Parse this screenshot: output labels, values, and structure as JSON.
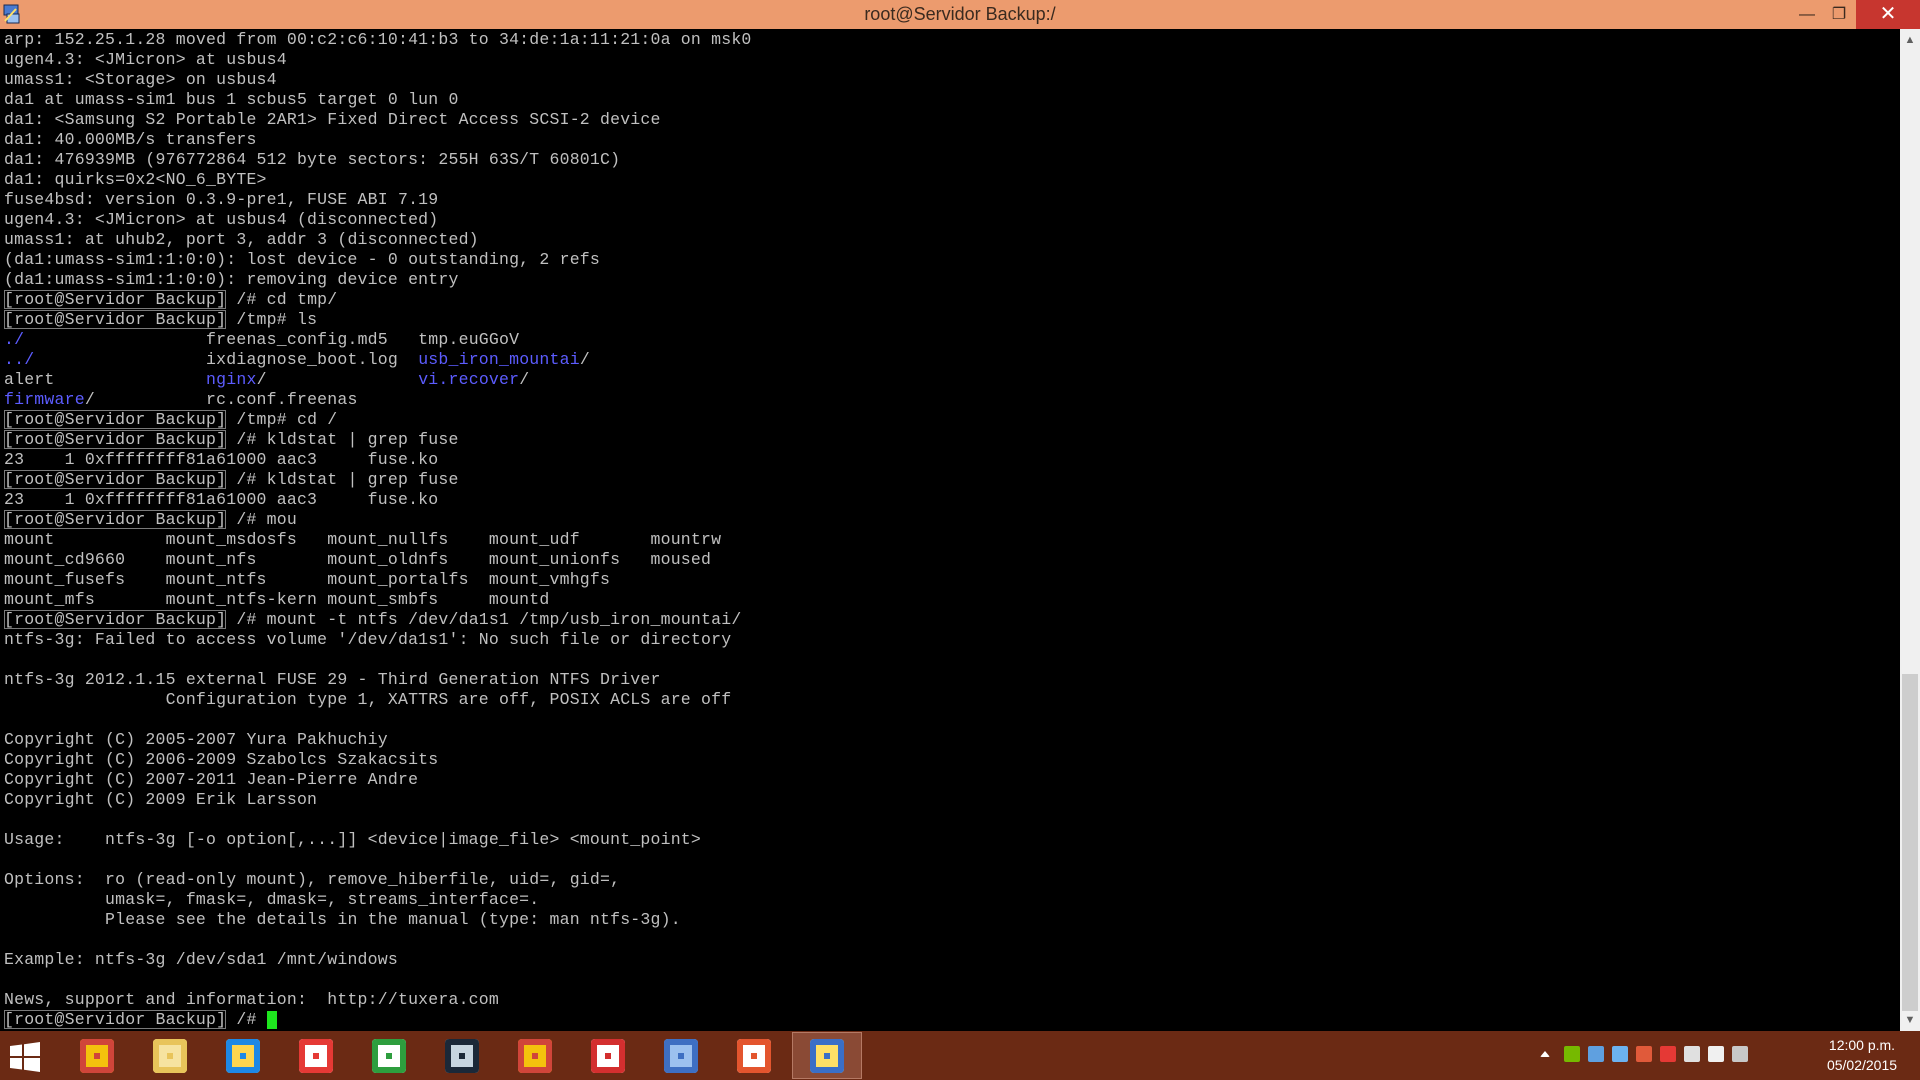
{
  "window": {
    "title": "root@Servidor Backup:/",
    "min_glyph": "—",
    "max_glyph": "❐",
    "close_glyph": "✕"
  },
  "terminal": {
    "lines": [
      {
        "segments": [
          {
            "text": "arp: 152.25.1.28 moved from 00:c2:c6:10:41:b3 to 34:de:1a:11:21:0a on msk0"
          }
        ]
      },
      {
        "segments": [
          {
            "text": "ugen4.3: <JMicron> at usbus4"
          }
        ]
      },
      {
        "segments": [
          {
            "text": "umass1: <Storage> on usbus4"
          }
        ]
      },
      {
        "segments": [
          {
            "text": "da1 at umass-sim1 bus 1 scbus5 target 0 lun 0"
          }
        ]
      },
      {
        "segments": [
          {
            "text": "da1: <Samsung S2 Portable 2AR1> Fixed Direct Access SCSI-2 device"
          }
        ]
      },
      {
        "segments": [
          {
            "text": "da1: 40.000MB/s transfers"
          }
        ]
      },
      {
        "segments": [
          {
            "text": "da1: 476939MB (976772864 512 byte sectors: 255H 63S/T 60801C)"
          }
        ]
      },
      {
        "segments": [
          {
            "text": "da1: quirks=0x2<NO_6_BYTE>"
          }
        ]
      },
      {
        "segments": [
          {
            "text": "fuse4bsd: version 0.3.9-pre1, FUSE ABI 7.19"
          }
        ]
      },
      {
        "segments": [
          {
            "text": "ugen4.3: <JMicron> at usbus4 (disconnected)"
          }
        ]
      },
      {
        "segments": [
          {
            "text": "umass1: at uhub2, port 3, addr 3 (disconnected)"
          }
        ]
      },
      {
        "segments": [
          {
            "text": "(da1:umass-sim1:1:0:0): lost device - 0 outstanding, 2 refs"
          }
        ]
      },
      {
        "segments": [
          {
            "text": "(da1:umass-sim1:1:0:0): removing device entry"
          }
        ]
      },
      {
        "segments": [
          {
            "text": "[root@Servidor Backup]",
            "cls": "prompt-box"
          },
          {
            "text": " /# cd tmp/"
          }
        ]
      },
      {
        "segments": [
          {
            "text": "[root@Servidor Backup]",
            "cls": "prompt-box"
          },
          {
            "text": " /tmp# ls"
          }
        ]
      },
      {
        "segments": [
          {
            "text": "./",
            "cls": "dir"
          },
          {
            "text": "                  freenas_config.md5   tmp.euGGoV"
          }
        ]
      },
      {
        "segments": [
          {
            "text": "../",
            "cls": "dir"
          },
          {
            "text": "                 ixdiagnose_boot.log  "
          },
          {
            "text": "usb_iron_mountai",
            "cls": "dir"
          },
          {
            "text": "/"
          }
        ]
      },
      {
        "segments": [
          {
            "text": "alert               "
          },
          {
            "text": "nginx",
            "cls": "dir"
          },
          {
            "text": "/               "
          },
          {
            "text": "vi.recover",
            "cls": "dir"
          },
          {
            "text": "/"
          }
        ]
      },
      {
        "segments": [
          {
            "text": "firmware",
            "cls": "dir"
          },
          {
            "text": "/           rc.conf.freenas"
          }
        ]
      },
      {
        "segments": [
          {
            "text": "[root@Servidor Backup]",
            "cls": "prompt-box"
          },
          {
            "text": " /tmp# cd /"
          }
        ]
      },
      {
        "segments": [
          {
            "text": "[root@Servidor Backup]",
            "cls": "prompt-box"
          },
          {
            "text": " /# kldstat | grep fuse"
          }
        ]
      },
      {
        "segments": [
          {
            "text": "23    1 0xffffffff81a61000 aac3     fuse.ko"
          }
        ]
      },
      {
        "segments": [
          {
            "text": "[root@Servidor Backup]",
            "cls": "prompt-box"
          },
          {
            "text": " /# kldstat | grep fuse"
          }
        ]
      },
      {
        "segments": [
          {
            "text": "23    1 0xffffffff81a61000 aac3     fuse.ko"
          }
        ]
      },
      {
        "segments": [
          {
            "text": "[root@Servidor Backup]",
            "cls": "prompt-box"
          },
          {
            "text": " /# mou"
          }
        ]
      },
      {
        "segments": [
          {
            "text": "mount           mount_msdosfs   mount_nullfs    mount_udf       mountrw"
          }
        ]
      },
      {
        "segments": [
          {
            "text": "mount_cd9660    mount_nfs       mount_oldnfs    mount_unionfs   moused"
          }
        ]
      },
      {
        "segments": [
          {
            "text": "mount_fusefs    mount_ntfs      mount_portalfs  mount_vmhgfs"
          }
        ]
      },
      {
        "segments": [
          {
            "text": "mount_mfs       mount_ntfs-kern mount_smbfs     mountd"
          }
        ]
      },
      {
        "segments": [
          {
            "text": "[root@Servidor Backup]",
            "cls": "prompt-box"
          },
          {
            "text": " /# mount -t ntfs /dev/da1s1 /tmp/usb_iron_mountai/"
          }
        ]
      },
      {
        "segments": [
          {
            "text": "ntfs-3g: Failed to access volume '/dev/da1s1': No such file or directory"
          }
        ]
      },
      {
        "segments": [
          {
            "text": ""
          }
        ]
      },
      {
        "segments": [
          {
            "text": "ntfs-3g 2012.1.15 external FUSE 29 - Third Generation NTFS Driver"
          }
        ]
      },
      {
        "segments": [
          {
            "text": "                Configuration type 1, XATTRS are off, POSIX ACLS are off"
          }
        ]
      },
      {
        "segments": [
          {
            "text": ""
          }
        ]
      },
      {
        "segments": [
          {
            "text": "Copyright (C) 2005-2007 Yura Pakhuchiy"
          }
        ]
      },
      {
        "segments": [
          {
            "text": "Copyright (C) 2006-2009 Szabolcs Szakacsits"
          }
        ]
      },
      {
        "segments": [
          {
            "text": "Copyright (C) 2007-2011 Jean-Pierre Andre"
          }
        ]
      },
      {
        "segments": [
          {
            "text": "Copyright (C) 2009 Erik Larsson"
          }
        ]
      },
      {
        "segments": [
          {
            "text": ""
          }
        ]
      },
      {
        "segments": [
          {
            "text": "Usage:    ntfs-3g [-o option[,...]] <device|image_file> <mount_point>"
          }
        ]
      },
      {
        "segments": [
          {
            "text": ""
          }
        ]
      },
      {
        "segments": [
          {
            "text": "Options:  ro (read-only mount), remove_hiberfile, uid=, gid=,"
          }
        ]
      },
      {
        "segments": [
          {
            "text": "          umask=, fmask=, dmask=, streams_interface=."
          }
        ]
      },
      {
        "segments": [
          {
            "text": "          Please see the details in the manual (type: man ntfs-3g)."
          }
        ]
      },
      {
        "segments": [
          {
            "text": ""
          }
        ]
      },
      {
        "segments": [
          {
            "text": "Example: ntfs-3g /dev/sda1 /mnt/windows"
          }
        ]
      },
      {
        "segments": [
          {
            "text": ""
          }
        ]
      },
      {
        "segments": [
          {
            "text": "News, support and information:  http://tuxera.com"
          }
        ]
      },
      {
        "segments": [
          {
            "text": "[root@Servidor Backup]",
            "cls": "prompt-box"
          },
          {
            "text": " /# "
          }
        ],
        "cursor": true
      }
    ]
  },
  "scrollbar": {
    "up_glyph": "▲",
    "down_glyph": "▼"
  },
  "taskbar": {
    "apps": [
      {
        "name": "chrome-icon",
        "color": "#d0453a",
        "accent": "#f4c20d"
      },
      {
        "name": "file-explorer-icon",
        "color": "#e8c45a",
        "accent": "#f6e3a0"
      },
      {
        "name": "internet-explorer-icon",
        "color": "#1e88e5",
        "accent": "#ffd54f"
      },
      {
        "name": "apps-grid-icon",
        "color": "#e53935",
        "accent": "#ffffff"
      },
      {
        "name": "store-icon",
        "color": "#2e9e3e",
        "accent": "#ffffff"
      },
      {
        "name": "steam-icon",
        "color": "#1b2838",
        "accent": "#c7d5e0"
      },
      {
        "name": "chrome-app-icon",
        "color": "#d0453a",
        "accent": "#f4c20d"
      },
      {
        "name": "acrobat-icon",
        "color": "#d32f2f",
        "accent": "#ffffff"
      },
      {
        "name": "remote-desktop-icon",
        "color": "#3e6fc2",
        "accent": "#9cc1ef"
      },
      {
        "name": "music-app-icon",
        "color": "#e3552e",
        "accent": "#ffffff"
      },
      {
        "name": "putty-icon",
        "color": "#3a6fc7",
        "accent": "#ffe066",
        "active": true
      }
    ],
    "tray": [
      {
        "name": "show-hidden-icons-icon",
        "color": "#ffffff"
      },
      {
        "name": "nvidia-icon",
        "color": "#76b900"
      },
      {
        "name": "monitor-icon",
        "color": "#5fa0e0"
      },
      {
        "name": "network-tray-icon",
        "color": "#6cb2f0"
      },
      {
        "name": "volume-icon",
        "color": "#e05a3a"
      },
      {
        "name": "warning-icon",
        "color": "#e53935"
      },
      {
        "name": "k-app-icon",
        "color": "#e0e0e0"
      },
      {
        "name": "battery-icon",
        "color": "#f0f0f0"
      },
      {
        "name": "network-icon",
        "color": "#c8c8c8"
      }
    ],
    "clock_time": "12:00 p.m.",
    "clock_date": "05/02/2015"
  }
}
